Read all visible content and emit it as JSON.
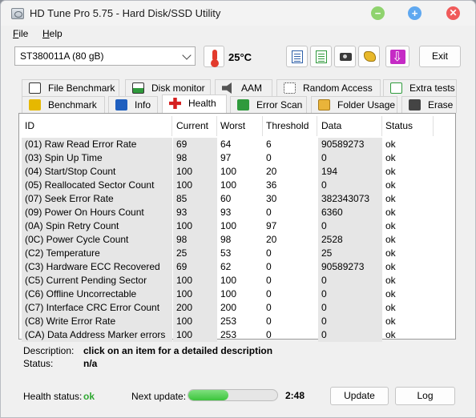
{
  "window": {
    "title": "HD Tune Pro 5.75 - Hard Disk/SSD Utility",
    "minimize": "−",
    "maximize": "+",
    "close": "✕"
  },
  "menu": {
    "file": "File",
    "help": "Help"
  },
  "toolbar": {
    "drive": "ST380011A (80 gB)",
    "temperature": "25°C",
    "exit": "Exit",
    "icons": [
      "thermometer-icon",
      "copy-text-icon",
      "copy-green-icon",
      "camera-icon",
      "hands-icon",
      "download-arrow-icon"
    ]
  },
  "tabs": {
    "file_benchmark": "File Benchmark",
    "disk_monitor": "Disk monitor",
    "aam": "AAM",
    "random_access": "Random Access",
    "extra_tests": "Extra tests",
    "benchmark": "Benchmark",
    "info": "Info",
    "health": "Health",
    "error_scan": "Error Scan",
    "folder_usage": "Folder Usage",
    "erase": "Erase",
    "active": "Health"
  },
  "table": {
    "columns": [
      "ID",
      "Current",
      "Worst",
      "Threshold",
      "Data",
      "Status"
    ],
    "rows": [
      [
        "(01) Raw Read Error Rate",
        "69",
        "64",
        "6",
        "90589273",
        "ok"
      ],
      [
        "(03) Spin Up Time",
        "98",
        "97",
        "0",
        "0",
        "ok"
      ],
      [
        "(04) Start/Stop Count",
        "100",
        "100",
        "20",
        "194",
        "ok"
      ],
      [
        "(05) Reallocated Sector Count",
        "100",
        "100",
        "36",
        "0",
        "ok"
      ],
      [
        "(07) Seek Error Rate",
        "85",
        "60",
        "30",
        "382343073",
        "ok"
      ],
      [
        "(09) Power On Hours Count",
        "93",
        "93",
        "0",
        "6360",
        "ok"
      ],
      [
        "(0A) Spin Retry Count",
        "100",
        "100",
        "97",
        "0",
        "ok"
      ],
      [
        "(0C) Power Cycle Count",
        "98",
        "98",
        "20",
        "2528",
        "ok"
      ],
      [
        "(C2) Temperature",
        "25",
        "53",
        "0",
        "25",
        "ok"
      ],
      [
        "(C3) Hardware ECC Recovered",
        "69",
        "62",
        "0",
        "90589273",
        "ok"
      ],
      [
        "(C5) Current Pending Sector",
        "100",
        "100",
        "0",
        "0",
        "ok"
      ],
      [
        "(C6) Offline Uncorrectable",
        "100",
        "100",
        "0",
        "0",
        "ok"
      ],
      [
        "(C7) Interface CRC Error Count",
        "200",
        "200",
        "0",
        "0",
        "ok"
      ],
      [
        "(C8) Write Error Rate",
        "100",
        "253",
        "0",
        "0",
        "ok"
      ],
      [
        "(CA) Data Address Marker errors",
        "100",
        "253",
        "0",
        "0",
        "ok"
      ]
    ]
  },
  "description": {
    "label": "Description:",
    "value": "click on an item for a detailed description",
    "status_label": "Status:",
    "status_value": "n/a"
  },
  "statusbar": {
    "health_label": "Health status:",
    "health_value": "ok",
    "next_update_label": "Next update:",
    "progress_fraction": 0.45,
    "timer": "2:48",
    "update": "Update",
    "log": "Log"
  },
  "colors": {
    "ok_green": "#2fa832",
    "progress_green": "#3cc43c",
    "close_red": "#f05a5a"
  }
}
